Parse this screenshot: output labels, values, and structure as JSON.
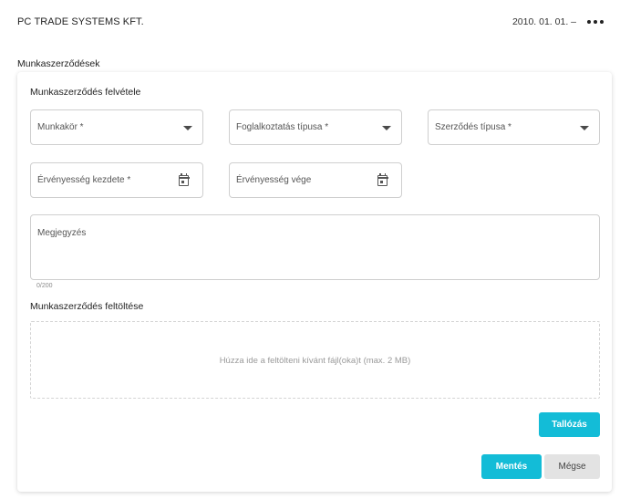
{
  "header": {
    "company": "PC TRADE SYSTEMS KFT.",
    "date_range": "2010. 01. 01. –"
  },
  "section_title": "Munkaszerződések",
  "form": {
    "title": "Munkaszerződés felvétele",
    "fields": {
      "position": "Munkakör *",
      "employment_type": "Foglalkoztatás típusa *",
      "contract_type": "Szerződés típusa *",
      "valid_from": "Érvényesség kezdete *",
      "valid_to": "Érvényesség vége"
    },
    "note": {
      "label": "Megjegyzés",
      "counter": "0/200"
    },
    "upload": {
      "title": "Munkaszerződés feltöltése",
      "hint": "Húzza ide a feltölteni kívánt fájl(oka)t (max. 2 MB)",
      "browse_label": "Tallózás"
    },
    "actions": {
      "save_label": "Mentés",
      "cancel_label": "Mégse"
    }
  },
  "colors": {
    "primary": "#13bcd7",
    "secondary": "#e3e3e3"
  },
  "icons": [
    "more-icon",
    "dropdown-caret-icon",
    "calendar-icon"
  ]
}
